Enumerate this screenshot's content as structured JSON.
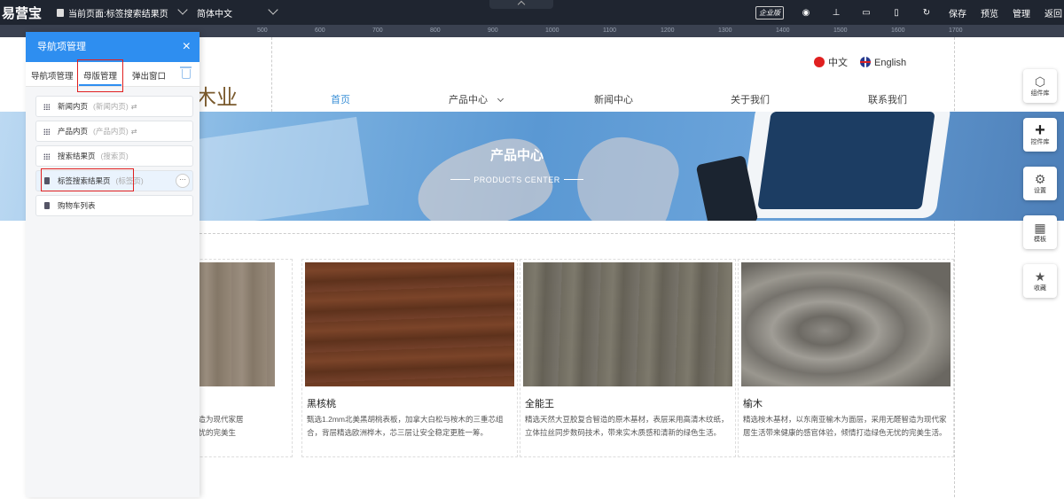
{
  "topbar": {
    "logo": "易营宝",
    "current_page": "当前页面:标签搜索结果页",
    "language": "简体中文",
    "edition_badge": "企业版",
    "save": "保存",
    "preview": "预览",
    "manage": "管理",
    "back": "返回"
  },
  "ruler": [
    "500",
    "600",
    "700",
    "800",
    "900",
    "1000",
    "1100",
    "1200",
    "1300",
    "1400",
    "1500",
    "1600",
    "1700"
  ],
  "site": {
    "brand_partial": "木业",
    "lang_cn": "中文",
    "lang_en": "English",
    "nav": [
      "首页",
      "产品中心",
      "新闻中心",
      "关于我们",
      "联系我们"
    ],
    "banner_title": "产品中心",
    "banner_subtitle": "PRODUCTS CENTER",
    "products": [
      {
        "name": "",
        "desc": "采用无甓智造为现代家居\n打造绿色无忧的完美生"
      },
      {
        "name": "黑核桃",
        "desc": "甄选1.2mm北美黑胡桃表板，加拿大白松与桉木的三重芯组合，背层精选欧洲桦木，芯三层让安全稳定更胜一筹。"
      },
      {
        "name": "全能王",
        "desc": "精选天然大豆胶复合智造的原木基材，表层采用高清木纹纸，立体拉丝同步数码技术，带来实木质感和清新的绿色生活。"
      },
      {
        "name": "榆木",
        "desc": "精选桉木基材，以东南亚榆木为面层，采用无醛智造为现代家居生活带来健康的感官体验，倾情打造绿色无忧的完美生活。"
      }
    ]
  },
  "dock": [
    "组件库",
    "控件库",
    "设置",
    "模板",
    "收藏"
  ],
  "panel": {
    "title": "导航项管理",
    "tabs": [
      "导航项管理",
      "母版管理",
      "弹出窗口"
    ],
    "pages": [
      {
        "name": "新闻内页",
        "sub": "(新闻内页)",
        "link": "⇄"
      },
      {
        "name": "产品内页",
        "sub": "(产品内页)",
        "link": "⇄"
      },
      {
        "name": "搜索结果页",
        "sub": "(搜索页)",
        "link": ""
      },
      {
        "name": "标签搜索结果页",
        "sub": "(标签页)",
        "link": ""
      },
      {
        "name": "购物车列表",
        "sub": "",
        "link": ""
      }
    ]
  }
}
